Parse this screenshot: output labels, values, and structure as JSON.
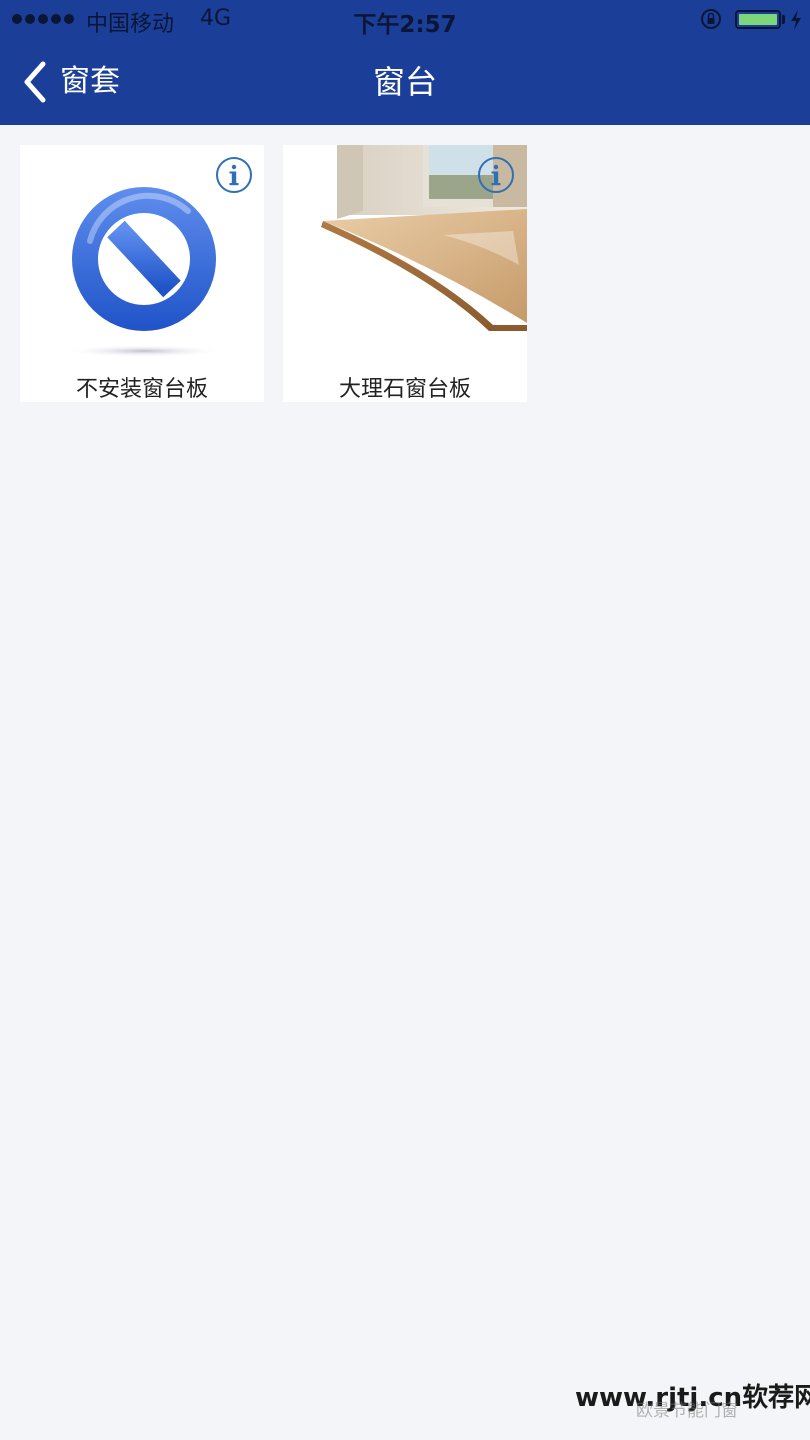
{
  "status_bar": {
    "carrier": "中国移动",
    "network": "4G",
    "time": "下午2:57",
    "battery_level": 1.0,
    "charging": true
  },
  "nav": {
    "back_label": "窗套",
    "title": "窗台"
  },
  "options": [
    {
      "label": "不安装窗台板",
      "image": "no-install-icon",
      "info": "info-icon"
    },
    {
      "label": "大理石窗台板",
      "image": "marble-windowsill-photo",
      "info": "info-icon"
    }
  ],
  "colors": {
    "header_bg": "#1b3f99",
    "page_bg": "#f4f5f8",
    "info_accent": "#2f6fb8",
    "battery_fill": "#7ed67a"
  },
  "watermark": {
    "main": "www.rjtj.cn软荐网",
    "sub": "欧景节能门窗"
  }
}
